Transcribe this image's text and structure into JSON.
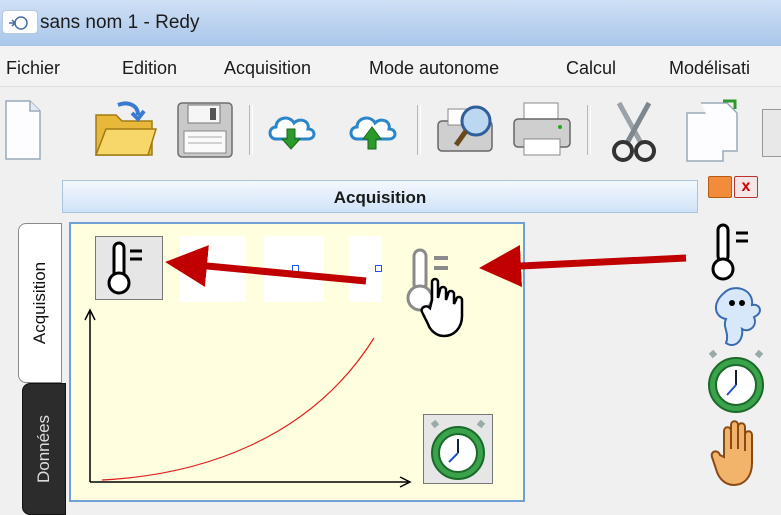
{
  "window": {
    "title": "sans nom 1 - Redy",
    "app_icon": "redy-app-icon"
  },
  "menubar": {
    "items": [
      {
        "label": "Fichier"
      },
      {
        "label": "Edition"
      },
      {
        "label": "Acquisition"
      },
      {
        "label": "Mode autonome"
      },
      {
        "label": "Calcul"
      },
      {
        "label": "Modélisati"
      }
    ]
  },
  "toolbar": {
    "icons": [
      "new-file-icon",
      "open-folder-icon",
      "save-disk-icon",
      "cloud-download-icon",
      "cloud-upload-icon",
      "print-preview-icon",
      "printer-icon",
      "scissors-icon",
      "copy-icon"
    ]
  },
  "side_tabs": [
    {
      "label": "Acquisition",
      "active": true
    },
    {
      "label": "Données",
      "active": false
    }
  ],
  "panel": {
    "title": "Acquisition",
    "close_label": "x"
  },
  "canvas_icons": [
    "thermometer-icon",
    "thermometer-hand-cursor-icon",
    "stopwatch-icon"
  ],
  "palette_icons": [
    "thermometer-icon",
    "ghost-icon",
    "stopwatch-icon",
    "hand-icon"
  ],
  "colors": {
    "arrow": "#c00000",
    "curve": "#e02020",
    "canvas_bg": "#fffedf",
    "canvas_border": "#6fa0d6"
  }
}
